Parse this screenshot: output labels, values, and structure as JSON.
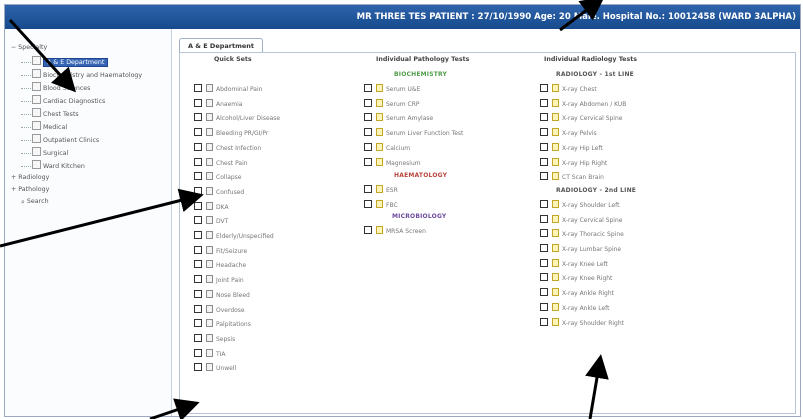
{
  "header": {
    "text": "MR THREE TES PATIENT : 27/10/1990 Age: 20 Male. Hospital No.: 10012458 (WARD 3ALPHA)"
  },
  "sidebar": {
    "root_label": "Specialty",
    "items": [
      {
        "label": "A & E Department",
        "selected": true
      },
      {
        "label": "Biochemistry and Haematology"
      },
      {
        "label": "Blood Sciences"
      },
      {
        "label": "Cardiac Diagnostics"
      },
      {
        "label": "Chest Tests"
      },
      {
        "label": "Medical"
      },
      {
        "label": "Outpatient Clinics"
      },
      {
        "label": "Surgical"
      },
      {
        "label": "Ward Kitchen"
      }
    ],
    "radiology_label": "Radiology",
    "pathology_label": "Pathology",
    "search_label": "Search"
  },
  "tab_label": "A & E Department",
  "columns": {
    "quick_sets_title": "Quick Sets",
    "pathology_title": "Individual Pathology Tests",
    "radiology_title": "Individual Radiology Tests"
  },
  "quick_sets": [
    "Abdominal Pain",
    "Anaemia",
    "Alcohol/Liver Disease",
    "Bleeding PR/GI/Pr",
    "Chest Infection",
    "Chest Pain",
    "Collapse",
    "Confused",
    "DKA",
    "DVT",
    "Elderly/Unspecified",
    "Fit/Seizure",
    "Headache",
    "Joint Pain",
    "Nose Bleed",
    "Overdose",
    "Palpitations",
    "Sepsis",
    "TIA",
    "Unwell"
  ],
  "pathology": {
    "biochem_title": "BIOCHEMISTRY",
    "biochem": [
      "Serum U&E",
      "Serum CRP",
      "Serum Amylase",
      "Serum Liver Function Test",
      "Calcium",
      "Magnesium"
    ],
    "haem_title": "HAEMATOLOGY",
    "haem": [
      "ESR",
      "FBC"
    ],
    "micro_title": "MICROBIOLOGY",
    "micro": [
      "MRSA Screen"
    ]
  },
  "radiology": {
    "section1_title": "RADIOLOGY - 1st LINE",
    "section1": [
      "X-ray Chest",
      "X-ray Abdomen / KUB",
      "X-ray Cervical Spine",
      "X-ray Pelvis",
      "X-ray Hip Left",
      "X-ray Hip Right",
      "CT Scan Brain"
    ],
    "section2_title": "RADIOLOGY - 2nd LINE",
    "section2": [
      "X-ray Shoulder Left",
      "X-ray Cervical Spine",
      "X-ray Thoracic Spine",
      "X-ray Lumbar Spine",
      "X-ray Knee Left",
      "X-ray Knee Right",
      "X-ray Ankle Right",
      "X-ray Ankle Left",
      "X-ray Shoulder Right"
    ]
  },
  "colors": {
    "header_blue": "#1f55a0",
    "selection_blue": "#3565b3",
    "biochem_green": "#4f9b4b",
    "haem_red": "#b9443c",
    "micro_purple": "#6c4a9c"
  }
}
